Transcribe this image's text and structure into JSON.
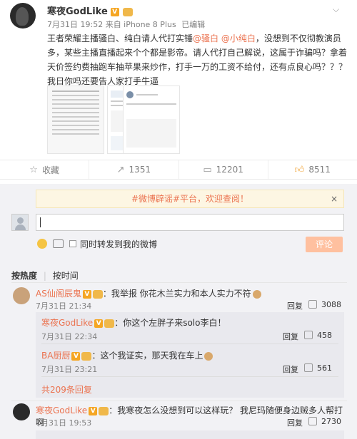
{
  "post": {
    "author": "寒夜GodLike",
    "v_badge": "V",
    "meta": "7月31日 19:52 来自 iPhone 8 Plus",
    "edited": "已编辑",
    "text_part1": "王者荣耀主播骚白、纯白请人代打实锤",
    "mention1": "@骚白",
    "mention2": "@小纯白",
    "text_part2": "，没想到不仅彻教演员多，某些主播直播起来个个都是影帝。请人代打自己解说，这属于诈骗吗？拿着天价签约费抽跑车抽苹果来炒作，打手一万的工资不给付，还有点良心吗？？？我日你吗还要告人家打手牛逼",
    "dropdown_icon": "chevron-down-icon"
  },
  "actions": {
    "favorite": "收藏",
    "repost": "1351",
    "comment": "12201",
    "like": "8511"
  },
  "comment_box": {
    "notice": "#微博辟谣#平台，欢迎查阅！",
    "close": "×",
    "sync_label": "同时转发到我的微博",
    "submit": "评论"
  },
  "sort": {
    "hot": "按热度",
    "time": "按时间"
  },
  "comments": [
    {
      "name": "AS仙阁辰鬼",
      "text": "：我举报 你花木兰实力和本人实力不符",
      "time": "7月31日 21:34",
      "reply": "回复",
      "likes": "3088",
      "replies": [
        {
          "name": "寒夜GodLike",
          "text": "：你这个左胖子来solo李白！",
          "time": "7月31日 22:34",
          "reply": "回复",
          "likes": "458"
        },
        {
          "name": "BA厨厨",
          "text": "：这个我证实，那天我在车上",
          "time": "7月31日 23:21",
          "reply": "回复",
          "likes": "561"
        }
      ],
      "more": "共209条回复"
    },
    {
      "name": "寒夜GodLike",
      "text": "：我寒夜怎么没想到可以这样玩？ 我尼玛随便身边贼多人帮打啊",
      "time": "7月31日 19:53",
      "reply": "回复",
      "likes": "2730"
    }
  ],
  "colors": {
    "accent": "#eb7350",
    "submit_bg": "#ffc09f",
    "comment_bg": "#f2f2f5"
  }
}
